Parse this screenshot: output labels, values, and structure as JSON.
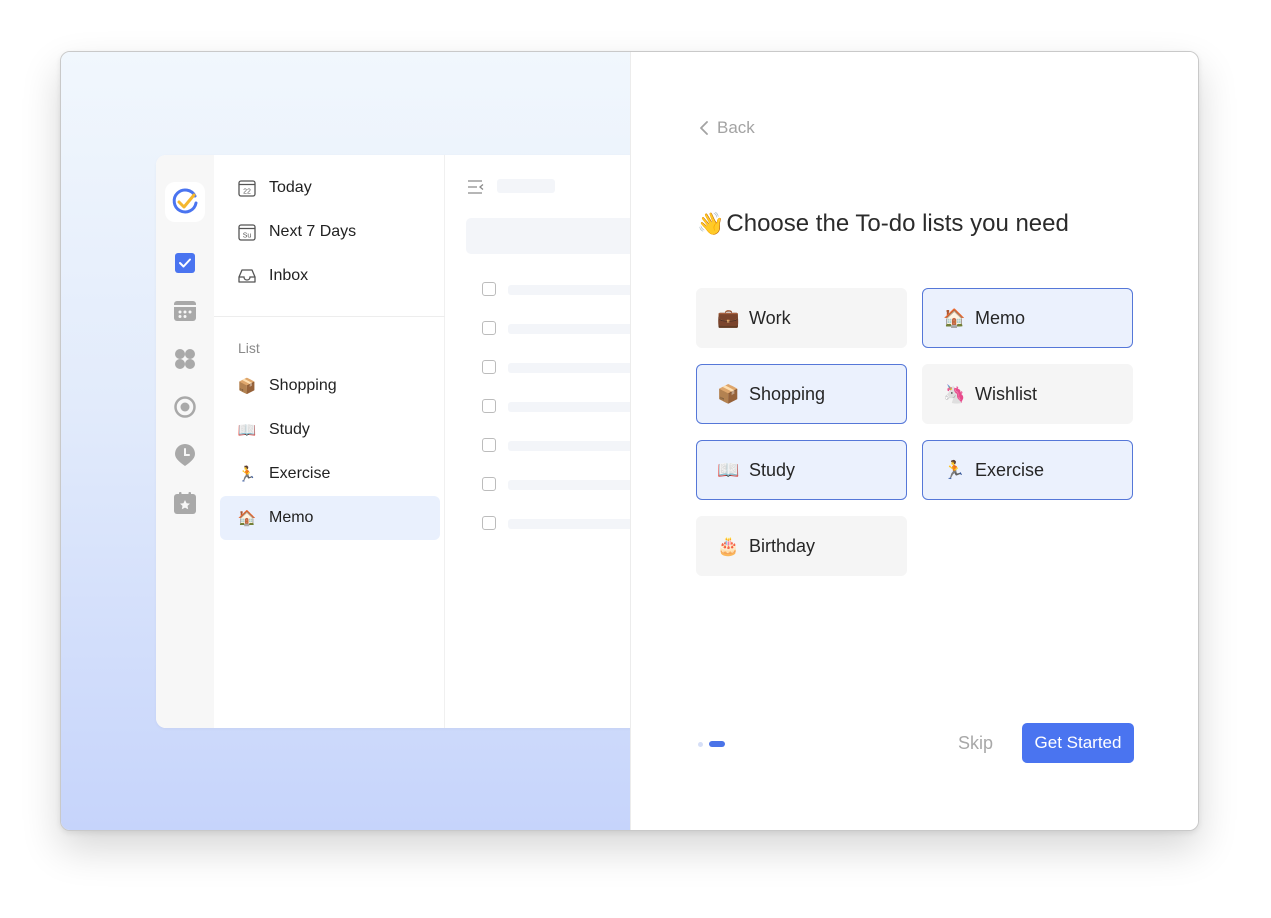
{
  "preview": {
    "nav": [
      {
        "label": "Today",
        "icon": "calendar-today-icon"
      },
      {
        "label": "Next 7 Days",
        "icon": "calendar-week-icon"
      },
      {
        "label": "Inbox",
        "icon": "inbox-icon"
      }
    ],
    "list_section_label": "List",
    "lists": [
      {
        "label": "Shopping",
        "emoji": "📦"
      },
      {
        "label": "Study",
        "emoji": "📖"
      },
      {
        "label": "Exercise",
        "emoji": "🏃"
      },
      {
        "label": "Memo",
        "emoji": "🏠",
        "active": true
      }
    ],
    "calendar_day": "22",
    "week_day": "Su"
  },
  "onboarding": {
    "back_label": "Back",
    "heading_emoji": "👋",
    "heading_text": "Choose the To-do lists you need",
    "options": [
      {
        "label": "Work",
        "emoji": "💼",
        "selected": false
      },
      {
        "label": "Memo",
        "emoji": "🏠",
        "selected": true
      },
      {
        "label": "Shopping",
        "emoji": "📦",
        "selected": true
      },
      {
        "label": "Wishlist",
        "emoji": "🦄",
        "selected": false
      },
      {
        "label": "Study",
        "emoji": "📖",
        "selected": true
      },
      {
        "label": "Exercise",
        "emoji": "🏃",
        "selected": true
      },
      {
        "label": "Birthday",
        "emoji": "🎂",
        "selected": false
      }
    ],
    "page_indicator": {
      "total": 2,
      "current": 2
    },
    "skip_label": "Skip",
    "start_label": "Get Started"
  },
  "colors": {
    "accent": "#4a74f0",
    "selected_bg": "#ebf1fd",
    "selected_border": "#5577d8"
  }
}
